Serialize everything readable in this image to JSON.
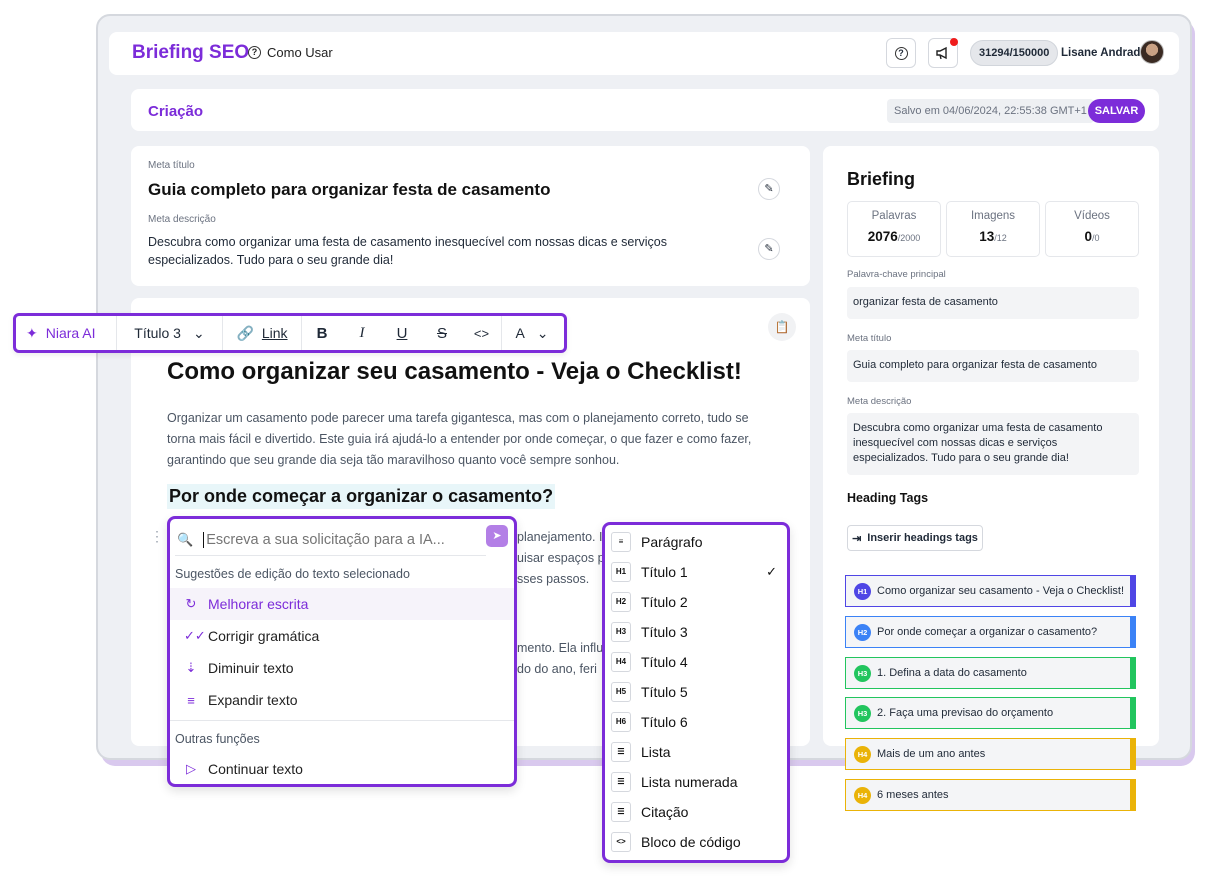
{
  "header": {
    "brand": "Briefing SEO",
    "help_link": "Como Usar",
    "credits": "31294/150000",
    "user_name": "Lisane Andrade"
  },
  "section": {
    "title": "Criação",
    "saved_status": "Salvo em 04/06/2024, 22:55:38 GMT+1",
    "save_button": "SALVAR"
  },
  "meta": {
    "title_label": "Meta título",
    "title": "Guia completo para organizar festa de casamento",
    "desc_label": "Meta descrição",
    "desc": "Descubra como organizar uma festa de casamento inesquecível com nossas dicas e serviços especializados. Tudo para o seu grande dia!"
  },
  "toolbar": {
    "ai_label": "Niara AI",
    "heading_select": "Título 3",
    "link_label": "Link",
    "bold": "B",
    "italic": "I",
    "underline": "U",
    "strike": "S",
    "code": "<>",
    "color": "A"
  },
  "editor": {
    "h1": "Como organizar seu casamento - Veja o Checklist!",
    "paragraph": "Organizar um casamento pode parecer uma tarefa gigantesca, mas com o planejamento correto, tudo se torna mais fácil e divertido. Este guia irá ajudá-lo a entender por onde começar, o que fazer e como fazer, garantindo que seu grande dia seja tão maravilhoso quanto você sempre sonhou.",
    "h2": "Por onde começar a organizar o casamento?",
    "fragments": [
      "planejamento. Iss",
      "uisar espaços pa",
      "sses passos.",
      "mento. Ela influenci",
      "do do ano, feri"
    ]
  },
  "ai_panel": {
    "placeholder": "Escreva a sua solicitação para a IA...",
    "group1": "Sugestões de edição do texto selecionado",
    "items": [
      "Melhorar escrita",
      "Corrigir gramática",
      "Diminuir texto",
      "Expandir texto"
    ],
    "group2": "Outras funções",
    "items2": [
      "Continuar texto"
    ]
  },
  "heading_menu": {
    "items": [
      {
        "icon": "≡",
        "label": "Parágrafo"
      },
      {
        "icon": "H1",
        "label": "Título 1",
        "checked": true
      },
      {
        "icon": "H2",
        "label": "Título 2"
      },
      {
        "icon": "H3",
        "label": "Título 3"
      },
      {
        "icon": "H4",
        "label": "Título 4"
      },
      {
        "icon": "H5",
        "label": "Título 5"
      },
      {
        "icon": "H6",
        "label": "Título 6"
      },
      {
        "icon": "☰",
        "label": "Lista"
      },
      {
        "icon": "☰",
        "label": "Lista numerada"
      },
      {
        "icon": "☰",
        "label": "Citação"
      },
      {
        "icon": "<>",
        "label": "Bloco de código"
      }
    ]
  },
  "briefing": {
    "title": "Briefing",
    "stats": [
      {
        "label": "Palavras",
        "value": "2076",
        "target": "/2000"
      },
      {
        "label": "Imagens",
        "value": "13",
        "target": "/12"
      },
      {
        "label": "Vídeos",
        "value": "0",
        "target": "/0"
      }
    ],
    "keyword_label": "Palavra-chave principal",
    "keyword": "organizar festa de casamento",
    "meta_title_label": "Meta título",
    "meta_title": "Guia completo para organizar festa de casamento",
    "meta_desc_label": "Meta descrição",
    "meta_desc": "Descubra como organizar uma festa de casamento inesquecível com nossas dicas e serviços especializados. Tudo para o seu grande dia!",
    "heading_tags_title": "Heading Tags",
    "insert_button": "Inserir headings tags",
    "tags": [
      {
        "level": "H1",
        "text": "Como organizar seu casamento - Veja o Checklist!",
        "color": "#4f46e5"
      },
      {
        "level": "H2",
        "text": "Por onde começar a organizar o casamento?",
        "color": "#3b82f6"
      },
      {
        "level": "H3",
        "text": "1. Defina a data do casamento",
        "color": "#22c55e"
      },
      {
        "level": "H3",
        "text": "2. Faça uma previsao do orçamento",
        "color": "#22c55e"
      },
      {
        "level": "H4",
        "text": "Mais de um ano antes",
        "color": "#eab308"
      },
      {
        "level": "H4",
        "text": "6 meses antes",
        "color": "#eab308"
      }
    ]
  },
  "colors": {
    "accent": "#7c2cd9",
    "h1": "#4f46e5",
    "h2": "#3b82f6",
    "h3": "#22c55e",
    "h4": "#eab308"
  }
}
